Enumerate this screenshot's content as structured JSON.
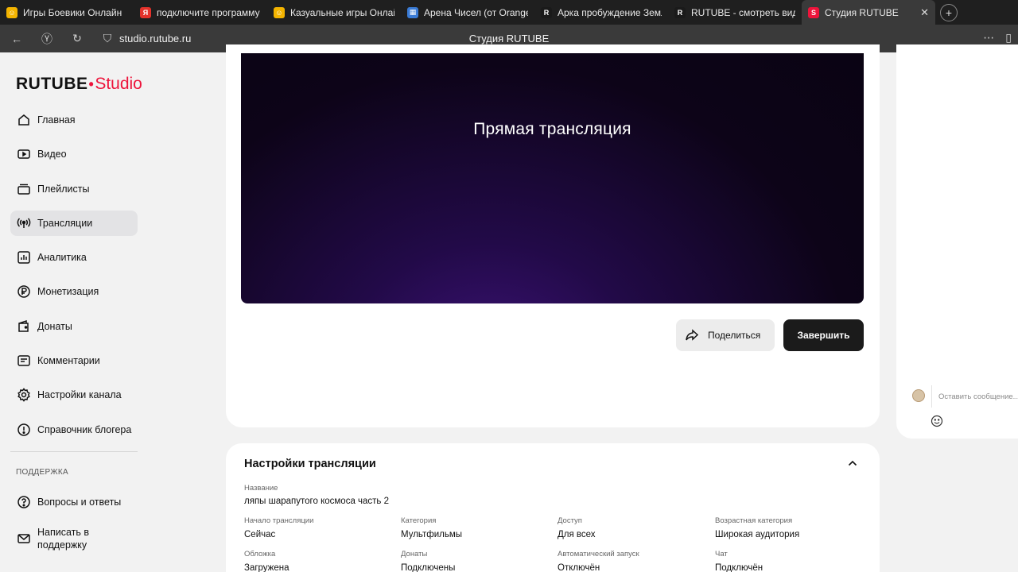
{
  "browser": {
    "tabs": [
      {
        "label": "Игры Боевики Онлайн",
        "fav_color": "#f4b400",
        "fav_glyph": "☺"
      },
      {
        "label": "подключите программу д",
        "fav_color": "#e4322b",
        "fav_glyph": "Я"
      },
      {
        "label": "Казуальные игры Онлай",
        "fav_color": "#f4b400",
        "fav_glyph": "☺"
      },
      {
        "label": "Арена Чисел (от Orange F",
        "fav_color": "#3a7bd5",
        "fav_glyph": "▦"
      },
      {
        "label": "Арка пробуждение Земл",
        "fav_color": "#1a1a1a",
        "fav_glyph": "R"
      },
      {
        "label": "RUTUBE - смотреть видео",
        "fav_color": "#1a1a1a",
        "fav_glyph": "R"
      },
      {
        "label": "Студия RUTUBE",
        "fav_color": "#ed143b",
        "fav_glyph": "S"
      }
    ],
    "url": "studio.rutube.ru",
    "page_title": "Студия RUTUBE"
  },
  "logo": {
    "brand": "RUTUBE",
    "suffix": "Studio"
  },
  "sidebar": {
    "items": [
      {
        "label": "Главная",
        "icon": "home-icon"
      },
      {
        "label": "Видео",
        "icon": "video-icon"
      },
      {
        "label": "Плейлисты",
        "icon": "playlist-icon"
      },
      {
        "label": "Трансляции",
        "icon": "broadcast-icon",
        "active": true
      },
      {
        "label": "Аналитика",
        "icon": "analytics-icon"
      },
      {
        "label": "Монетизация",
        "icon": "monetization-icon"
      },
      {
        "label": "Донаты",
        "icon": "wallet-icon"
      },
      {
        "label": "Комментарии",
        "icon": "comments-icon"
      },
      {
        "label": "Настройки канала",
        "icon": "gear-icon"
      },
      {
        "label": "Справочник блогера",
        "icon": "help-icon"
      }
    ],
    "support_label": "ПОДДЕРЖКА",
    "support_items": [
      {
        "label": "Вопросы и ответы",
        "icon": "faq-icon"
      },
      {
        "label": "Написать в поддержку",
        "icon": "mail-icon"
      }
    ]
  },
  "player": {
    "title": "Прямая трансляция"
  },
  "actions": {
    "share_label": "Поделиться",
    "end_label": "Завершить"
  },
  "chat": {
    "placeholder": "Оставить сообщение..."
  },
  "settings": {
    "title": "Настройки трансляции",
    "name_label": "Название",
    "name_value": "ляпы шарапутого космоса часть 2",
    "fields": [
      {
        "label": "Начало трансляции",
        "value": "Сейчас"
      },
      {
        "label": "Категория",
        "value": "Мультфильмы"
      },
      {
        "label": "Доступ",
        "value": "Для всех"
      },
      {
        "label": "Возрастная категория",
        "value": "Широкая аудитория"
      },
      {
        "label": "Обложка",
        "value": "Загружена"
      },
      {
        "label": "Донаты",
        "value": "Подключены"
      },
      {
        "label": "Автоматический запуск",
        "value": "Отключён"
      },
      {
        "label": "Чат",
        "value": "Подключён"
      }
    ]
  },
  "colors": {
    "accent": "#ed143b",
    "active_nav_bg": "#e3e3e5",
    "end_button": "#1b1b1b"
  }
}
